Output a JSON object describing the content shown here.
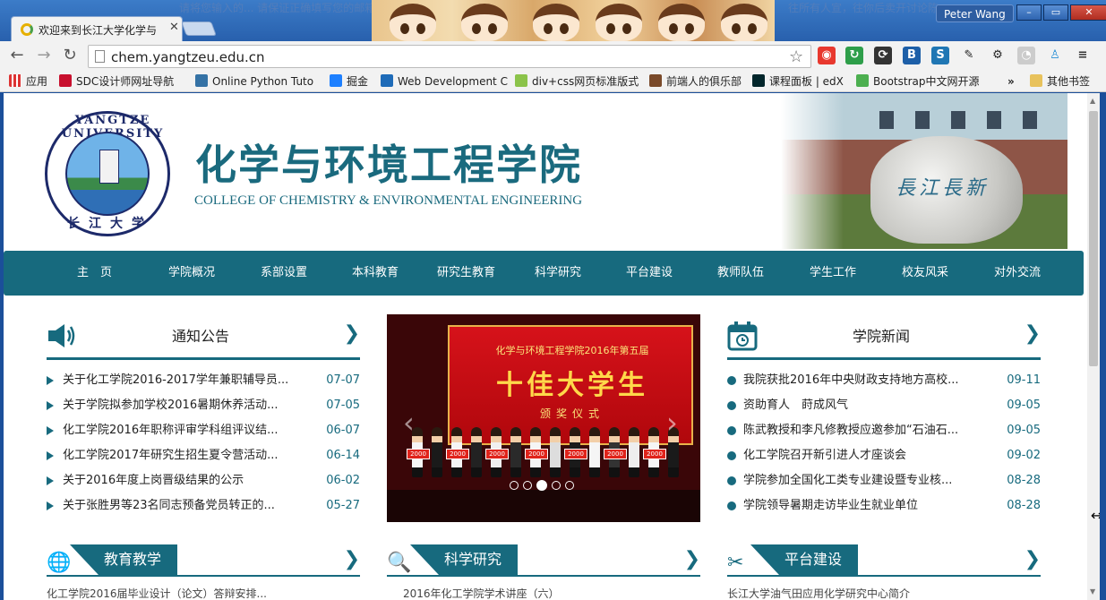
{
  "browser": {
    "tab_title": "欢迎来到长江大学化学与",
    "url": "chem.yangtzeu.edu.cn",
    "user_name": "Peter Wang",
    "window_controls": [
      "–",
      "▭",
      "✕"
    ],
    "ghost_text_left": "请将您输入的...  请保证正确填写您的邮箱地址",
    "ghost_text_right": "往所有人宣，往你后卖开讨论陈"
  },
  "bookmarks": [
    {
      "label": "应用",
      "color": "#d33"
    },
    {
      "label": "SDC设计师网址导航",
      "color": "#c8102e"
    },
    {
      "label": "Online Python Tuto",
      "color": "#3572a5"
    },
    {
      "label": "掘金",
      "color": "#1e80ff"
    },
    {
      "label": "Web Development C",
      "color": "#1e6bb8"
    },
    {
      "label": "div+css网页标准版式",
      "color": "#8bc34a"
    },
    {
      "label": "前端人的俱乐部",
      "color": "#7a4a2a"
    },
    {
      "label": "课程面板 | edX",
      "color": "#02262b"
    },
    {
      "label": "Bootstrap中文网开源",
      "color": "#4caf50"
    },
    {
      "label": "»",
      "color": ""
    },
    {
      "label": "其他书签",
      "color": "#e8c25c"
    }
  ],
  "header": {
    "logo_top_text": "YANGTZE UNIVERSITY",
    "logo_bottom_text": "长江大学",
    "college_cn": "化学与环境工程学院",
    "college_en": "COLLEGE OF CHEMISTRY & ENVIRONMENTAL ENGINEERING",
    "stone_text": "長江長新"
  },
  "nav": [
    "主　页",
    "学院概况",
    "系部设置",
    "本科教育",
    "研究生教育",
    "科学研究",
    "平台建设",
    "教师队伍",
    "学生工作",
    "校友风采",
    "对外交流"
  ],
  "notices": {
    "title": "通知公告",
    "items": [
      {
        "title": "关于化工学院2016-2017学年兼职辅导员...",
        "date": "07-07"
      },
      {
        "title": "关于学院拟参加学校2016暑期休养活动...",
        "date": "07-05"
      },
      {
        "title": "化工学院2016年职称评审学科组评议结...",
        "date": "06-07"
      },
      {
        "title": "化工学院2017年研究生招生夏令营活动...",
        "date": "06-14"
      },
      {
        "title": "关于2016年度上岗晋级结果的公示",
        "date": "06-02"
      },
      {
        "title": "关于张胜男等23名同志预备党员转正的...",
        "date": "05-27"
      }
    ]
  },
  "carousel": {
    "banner_top": "化学与环境工程学院2016年第五届",
    "banner_main": "十佳大学生",
    "banner_sub": "颁奖仪式",
    "board_text": "2000",
    "prev": "‹",
    "next": "›",
    "slide_count": 5,
    "active_index": 2
  },
  "news": {
    "title": "学院新闻",
    "items": [
      {
        "title": "我院获批2016年中央财政支持地方高校...",
        "date": "09-11"
      },
      {
        "title": "资助育人　莳成风气",
        "date": "09-05"
      },
      {
        "title": "陈武教授和李凡修教授应邀参加“石油石...",
        "date": "09-05"
      },
      {
        "title": "化工学院召开新引进人才座谈会",
        "date": "09-02"
      },
      {
        "title": "学院参加全国化工类专业建设暨专业核...",
        "date": "08-28"
      },
      {
        "title": "学院领导暑期走访毕业生就业单位",
        "date": "08-28"
      }
    ]
  },
  "bottom_sections": [
    {
      "title": "教育教学",
      "peek": "化工学院2016届毕业设计（论文）答辩安排..."
    },
    {
      "title": "科学研究",
      "peek": "2016年化工学院学术讲座（六）"
    },
    {
      "title": "平台建设",
      "peek": "长江大学油气田应用化学研究中心简介"
    }
  ],
  "colors": {
    "accent": "#176a7e",
    "chrome": "#2860ad"
  }
}
